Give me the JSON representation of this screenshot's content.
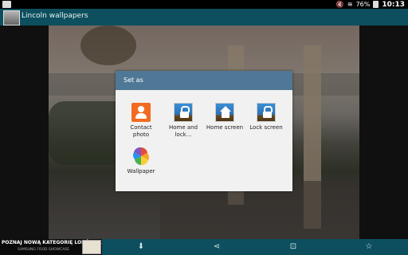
{
  "status_bar": {
    "battery_percent": "76%",
    "time": "10:13"
  },
  "app_bar": {
    "title": "Lincoln wallpapers"
  },
  "dialog": {
    "title": "Set as",
    "options": [
      {
        "label": "Contact photo",
        "icon": "contact-icon"
      },
      {
        "label": "Home and lock...",
        "icon": "home-lock-icon"
      },
      {
        "label": "Home screen",
        "icon": "home-screen-icon"
      },
      {
        "label": "Lock screen",
        "icon": "lock-screen-icon"
      },
      {
        "label": "Wallpaper",
        "icon": "wallpaper-icon"
      }
    ]
  },
  "ad_banner": {
    "headline": "POZNAJ NOWĄ KATEGORIĘ LODÓWEK",
    "subline": "SAMSUNG FOOD SHOWCASE"
  },
  "bottom_actions": [
    {
      "name": "download-icon",
      "glyph": "⬇"
    },
    {
      "name": "share-icon",
      "glyph": "⋖"
    },
    {
      "name": "crop-icon",
      "glyph": "⊡"
    },
    {
      "name": "star-icon",
      "glyph": "☆"
    }
  ],
  "colors": {
    "app_bar": "#0d4f5e",
    "dialog_header": "#4f7896",
    "contact_icon": "#f26b22"
  }
}
